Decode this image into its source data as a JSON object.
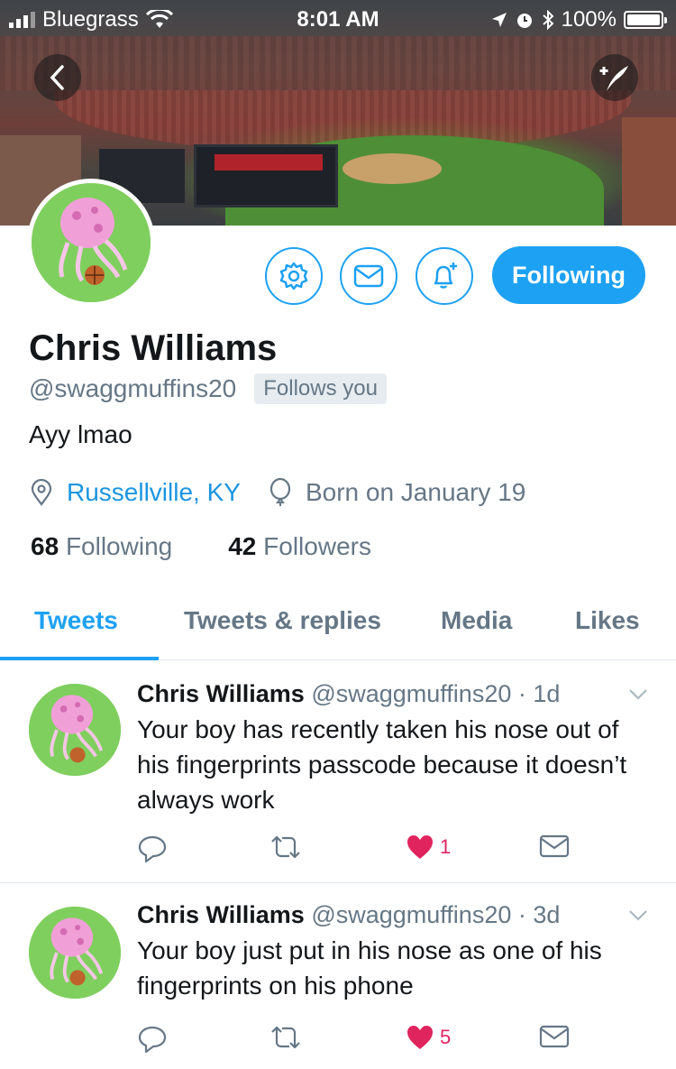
{
  "status_bar": {
    "carrier": "Bluegrass",
    "time": "8:01 AM",
    "battery": "100%"
  },
  "profile": {
    "name": "Chris Williams",
    "handle": "@swaggmuffins20",
    "follows_you": "Follows you",
    "bio": "Ayy lmao",
    "location": "Russellville, KY",
    "birthday": "Born on January 19",
    "following_count": "68",
    "following_label": "Following",
    "followers_count": "42",
    "followers_label": "Followers",
    "follow_button": "Following"
  },
  "tabs": [
    {
      "label": "Tweets",
      "active": true
    },
    {
      "label": "Tweets & replies",
      "active": false
    },
    {
      "label": "Media",
      "active": false
    },
    {
      "label": "Likes",
      "active": false
    }
  ],
  "tweets": [
    {
      "name": "Chris Williams",
      "handle": "@swaggmuffins20",
      "time": "1d",
      "text": "Your boy has recently taken his nose out of his fingerprints passcode because it doesn’t always work",
      "likes": "1"
    },
    {
      "name": "Chris Williams",
      "handle": "@swaggmuffins20",
      "time": "3d",
      "text": "Your boy just put in his nose as one of his fingerprints on his phone",
      "likes": "5"
    }
  ],
  "colors": {
    "accent": "#1da1f2",
    "like": "#e0245e",
    "muted": "#657786"
  },
  "icons": [
    "back-icon",
    "compose-icon",
    "gear-icon",
    "mail-icon",
    "bell-plus-icon",
    "location-icon",
    "balloon-icon",
    "reply-icon",
    "retweet-icon",
    "heart-icon",
    "chevron-down-icon"
  ]
}
